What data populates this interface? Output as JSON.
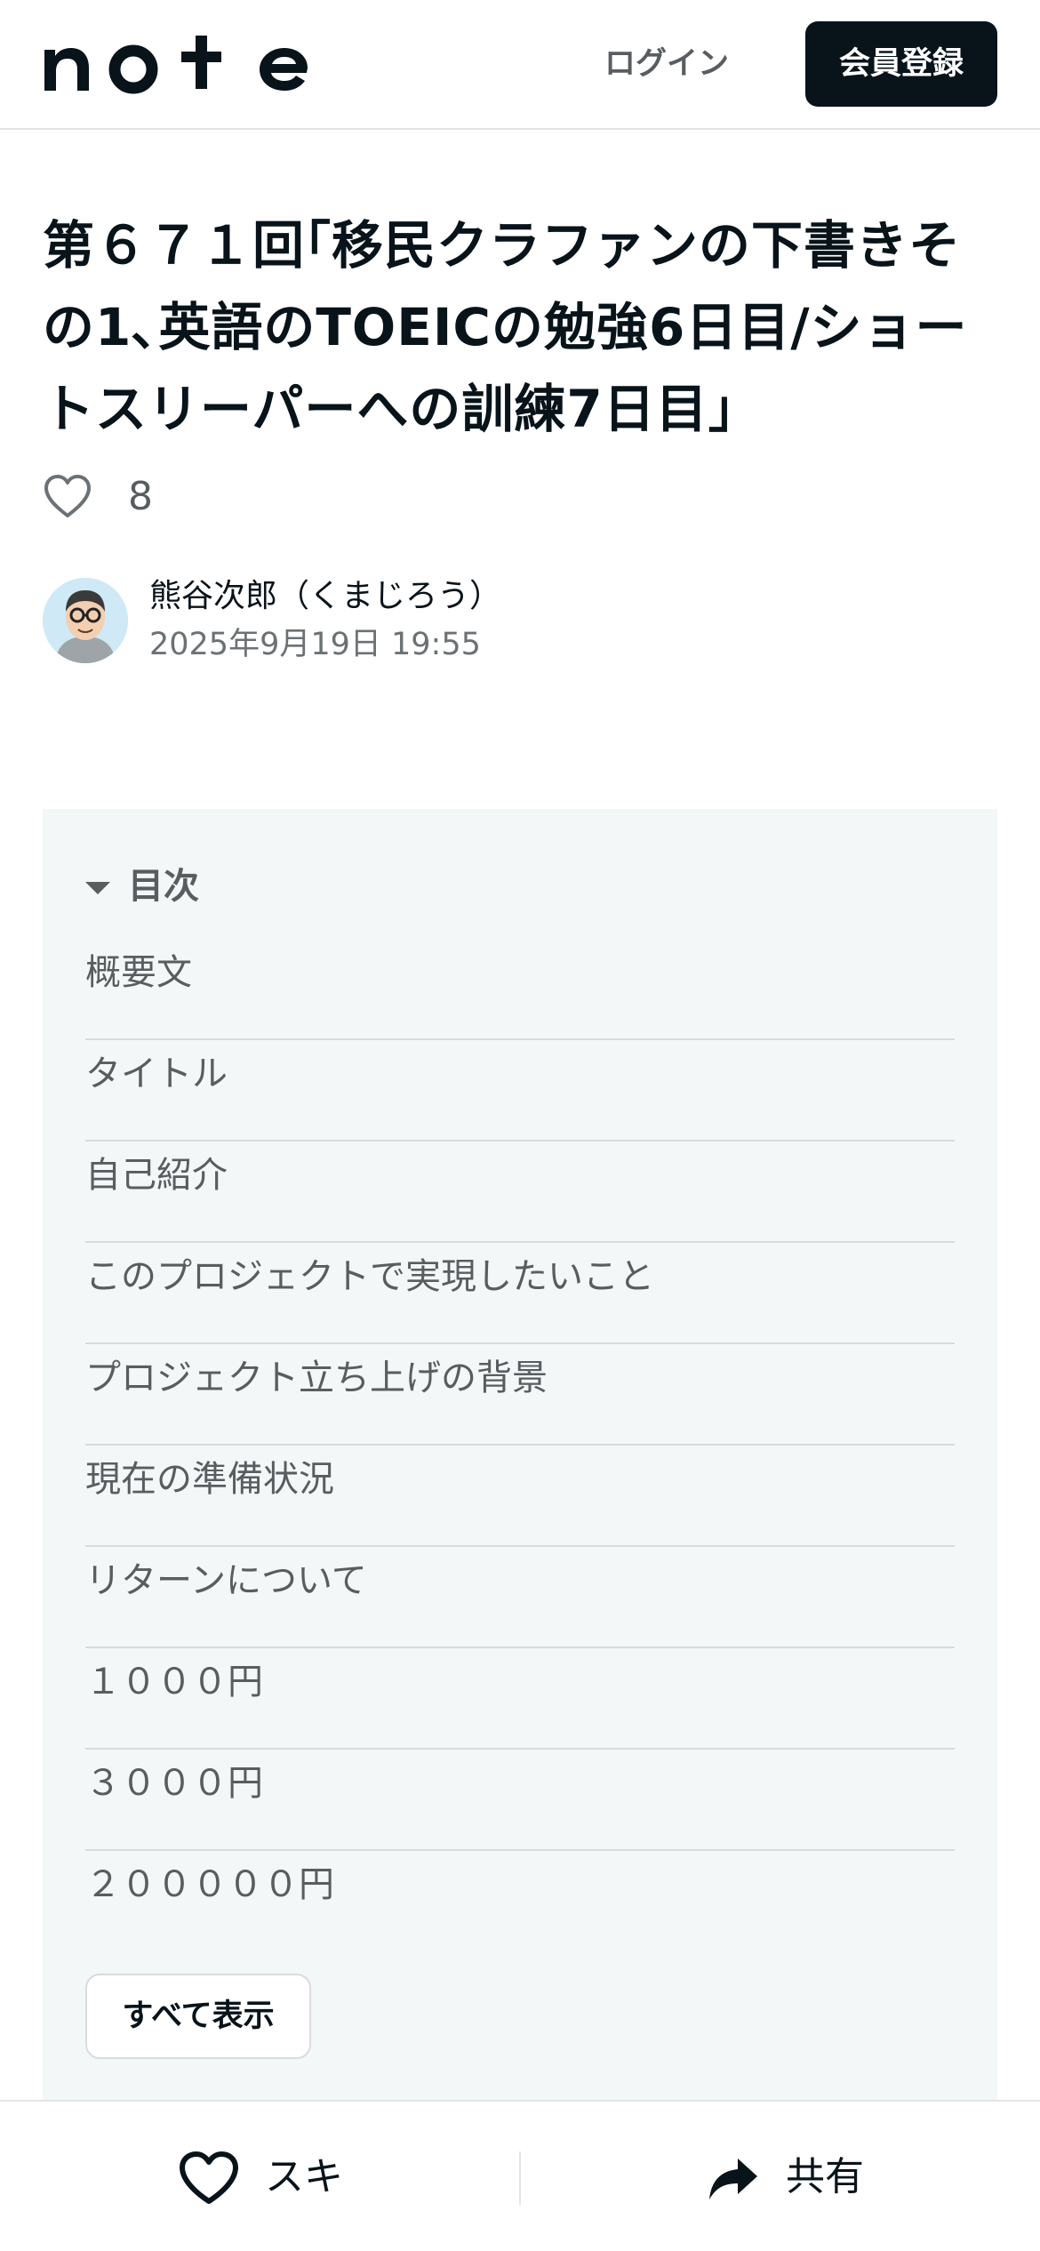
{
  "header": {
    "logo_text": "note",
    "login_label": "ログイン",
    "signup_label": "会員登録"
  },
  "article": {
    "title": "第６７１回｢移民クラファンの下書きその1､英語のTOEICの勉強6日目/ショートスリーパーへの訓練7日目｣",
    "like_count": "8",
    "author_name": "熊谷次郎（くまじろう）",
    "post_date": "2025年9月19日 19:55"
  },
  "toc": {
    "title": "目次",
    "items": [
      "概要文",
      "タイトル",
      "自己紹介",
      "このプロジェクトで実現したいこと",
      "プロジェクト立ち上げの背景",
      "現在の準備状況",
      "リターンについて",
      "１０００円",
      "３０００円",
      "２０００００円"
    ],
    "show_all_label": "すべて表示"
  },
  "bottom_bar": {
    "like_label": "スキ",
    "share_label": "共有"
  }
}
